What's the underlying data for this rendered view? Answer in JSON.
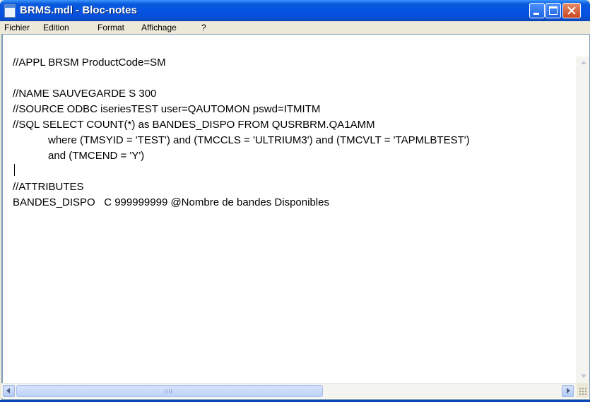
{
  "window": {
    "title": "BRMS.mdl - Bloc-notes",
    "title_color": "#0554e3",
    "close_color": "#d35a30"
  },
  "menu": {
    "items": [
      "Fichier",
      "Edition",
      "Format",
      "Affichage",
      "?"
    ]
  },
  "editor": {
    "lines": [
      "//APPL BRSM ProductCode=SM",
      "",
      "//NAME SAUVEGARDE S 300",
      "//SOURCE ODBC iseriesTEST user=QAUTOMON pswd=ITMITM",
      "//SQL SELECT COUNT(*) as BANDES_DISPO FROM QUSRBRM.QA1AMM",
      "            where (TMSYID = 'TEST') and (TMCCLS = 'ULTRIUM3') and (TMCVLT = 'TAPMLBTEST')",
      "            and (TMCEND = 'Y')",
      "",
      "//ATTRIBUTES",
      "BANDES_DISPO   C 999999999 @Nombre de bandes Disponibles"
    ]
  },
  "icons": {
    "app": "notepad-icon",
    "minimize": "minimize-icon",
    "maximize": "maximize-icon",
    "close": "close-icon",
    "scroll_up": "arrow-up-icon",
    "scroll_down": "arrow-down-icon",
    "scroll_left": "arrow-left-icon",
    "scroll_right": "arrow-right-icon",
    "size_grip": "size-grip-icon"
  }
}
